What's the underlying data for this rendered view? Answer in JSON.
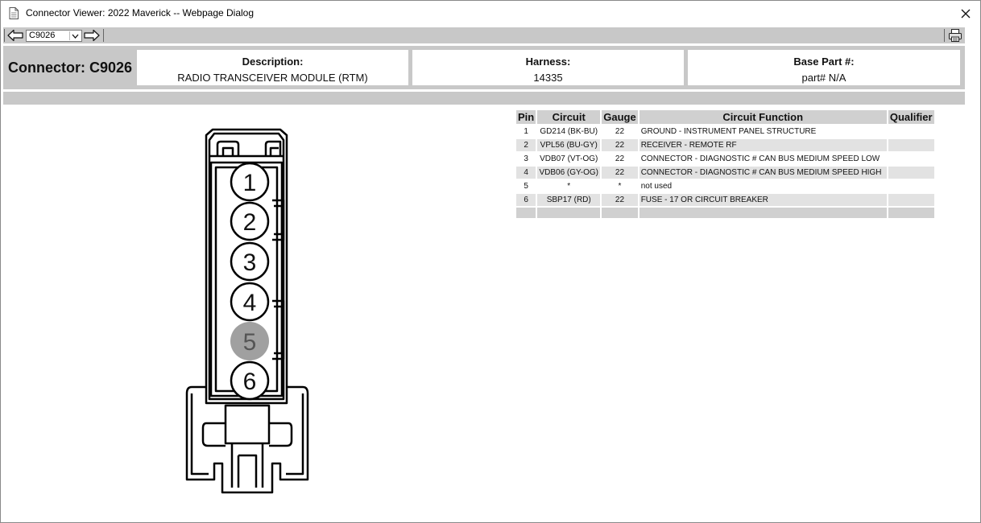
{
  "window": {
    "title": "Connector Viewer: 2022 Maverick -- Webpage Dialog",
    "close_icon": "close-icon"
  },
  "toolbar": {
    "back_icon": "arrow-left-icon",
    "forward_icon": "arrow-right-icon",
    "print_icon": "printer-icon",
    "connector_select_value": "C9026"
  },
  "header": {
    "connector_label": "Connector: C9026",
    "description_label": "Description:",
    "description_value": "RADIO TRANSCEIVER MODULE (RTM)",
    "harness_label": "Harness:",
    "harness_value": "14335",
    "base_part_label": "Base Part #:",
    "base_part_value": "part# N/A"
  },
  "table": {
    "columns": [
      "Pin",
      "Circuit",
      "Gauge",
      "Circuit Function",
      "Qualifier"
    ],
    "rows": [
      {
        "pin": "1",
        "circuit": "GD214 (BK-BU)",
        "gauge": "22",
        "function": "GROUND - INSTRUMENT PANEL STRUCTURE",
        "qualifier": ""
      },
      {
        "pin": "2",
        "circuit": "VPL56 (BU-GY)",
        "gauge": "22",
        "function": "RECEIVER - REMOTE RF",
        "qualifier": ""
      },
      {
        "pin": "3",
        "circuit": "VDB07 (VT-OG)",
        "gauge": "22",
        "function": "CONNECTOR - DIAGNOSTIC # CAN BUS MEDIUM SPEED LOW",
        "qualifier": ""
      },
      {
        "pin": "4",
        "circuit": "VDB06 (GY-OG)",
        "gauge": "22",
        "function": "CONNECTOR - DIAGNOSTIC # CAN BUS MEDIUM SPEED HIGH",
        "qualifier": ""
      },
      {
        "pin": "5",
        "circuit": "*",
        "gauge": "*",
        "function": "not used",
        "qualifier": ""
      },
      {
        "pin": "6",
        "circuit": "SBP17 (RD)",
        "gauge": "22",
        "function": "FUSE - 17 OR CIRCUIT BREAKER",
        "qualifier": ""
      }
    ]
  },
  "diagram": {
    "pins": [
      "1",
      "2",
      "3",
      "4",
      "5",
      "6"
    ],
    "unused_pins": [
      "5"
    ],
    "colors": {
      "pin_used": "#ffffff",
      "pin_unused": "#a0a0a0",
      "outline": "#000000"
    }
  }
}
